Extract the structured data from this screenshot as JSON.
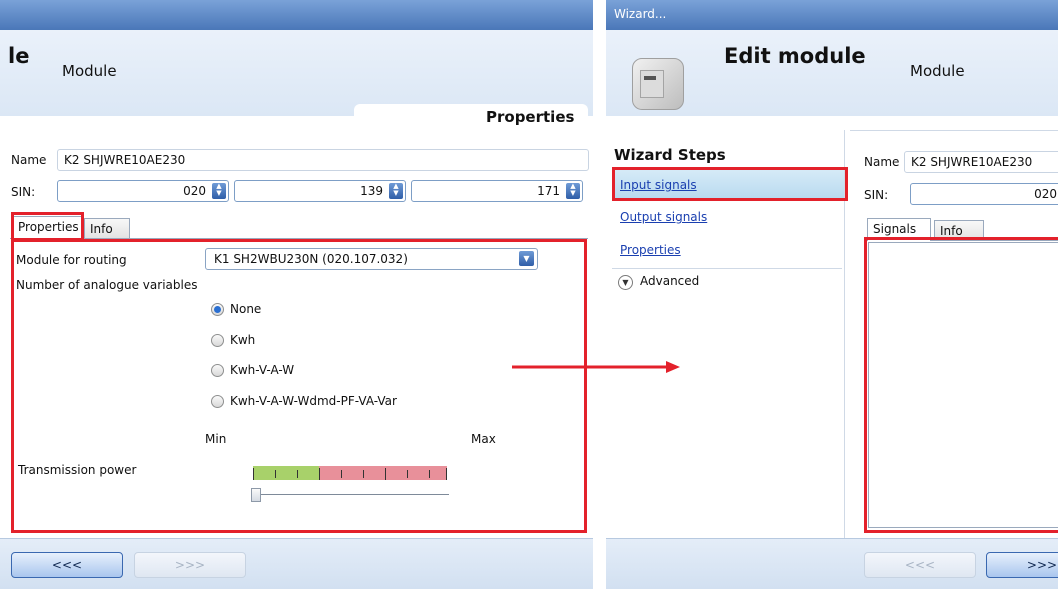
{
  "left": {
    "title_fragment": "le",
    "subtitle": "Module",
    "section_title": "Properties",
    "name_label": "Name",
    "name_value": "K2 SHJWRE10AE230",
    "sin_label": "SIN:",
    "sin_values": [
      "020",
      "139",
      "171"
    ],
    "tabs": [
      "Properties",
      "Info"
    ],
    "routing_label": "Module for routing",
    "routing_value": "K1 SH2WBU230N (020.107.032)",
    "analogue_label": "Number of analogue variables",
    "radio_options": [
      "None",
      "Kwh",
      "Kwh-V-A-W",
      "Kwh-V-A-W-Wdmd-PF-VA-Var"
    ],
    "radio_selected": "None",
    "min_label": "Min",
    "max_label": "Max",
    "transmission_label": "Transmission power",
    "transmission_level": 0,
    "prev_button": "<<<",
    "next_button": ">>>"
  },
  "right": {
    "window_title": "Wizard...",
    "title": "Edit module",
    "subtitle": "Module",
    "steps_heading": "Wizard Steps",
    "steps": [
      "Input signals",
      "Output signals",
      "Properties"
    ],
    "advanced_label": "Advanced",
    "name_label": "Name",
    "name_value": "K2 SHJWRE10AE230",
    "sin_label": "SIN:",
    "sin_value": "020",
    "tabs": [
      "Signals",
      "Info"
    ],
    "prev_button": "<<<",
    "next_button": ">>>"
  },
  "colors": {
    "highlight_red": "#e3212b",
    "titlebar_blue": "#4a77b8",
    "link_blue": "#1a3fb0",
    "meter_green": "#a8d16a",
    "meter_red": "#e8909a"
  }
}
